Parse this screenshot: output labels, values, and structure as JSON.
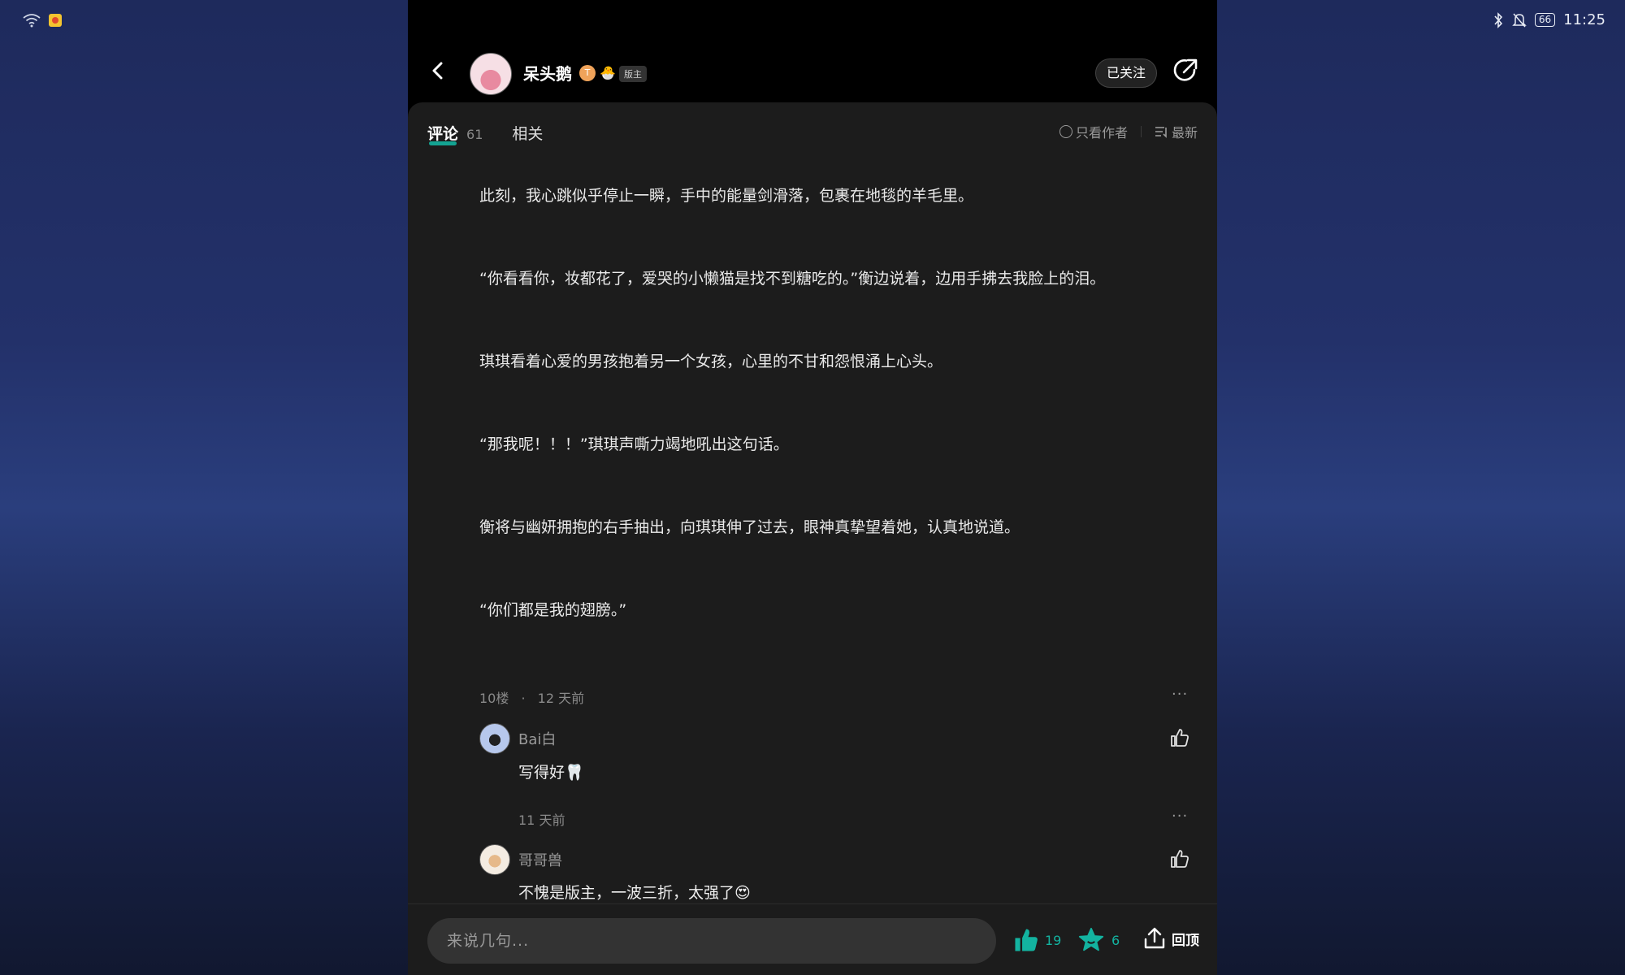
{
  "status_bar": {
    "time": "11:25",
    "battery": "66",
    "icons": [
      "wifi-icon",
      "app-notification-icon",
      "bluetooth-icon",
      "mute-bell-icon",
      "battery-icon"
    ]
  },
  "header": {
    "author_name": "呆头鹅",
    "level_badge": "T",
    "emoji_badge": "🐣",
    "moderator_badge": "版主",
    "follow_label": "已关注"
  },
  "tabs": {
    "comments_label": "评论",
    "comments_count": "61",
    "related_label": "相关"
  },
  "filters": {
    "author_only": "只看作者",
    "sort": "最新"
  },
  "story": [
    "此刻，我心跳似乎停止一瞬，手中的能量剑滑落，包裹在地毯的羊毛里。",
    "“你看看你，妆都花了，爱哭的小懒猫是找不到糖吃的。”衡边说着，边用手拂去我脸上的泪。",
    "琪琪看着心爱的男孩抱着另一个女孩，心里的不甘和怨恨涌上心头。",
    "“那我呢！！！”琪琪声嘶力竭地吼出这句话。",
    "衡将与幽妍拥抱的右手抽出，向琪琪伸了过去，眼神真挚望着她，认真地说道。",
    "“你们都是我的翅膀。”"
  ],
  "post_meta": {
    "floor": "10楼",
    "dot": "·",
    "time": "12 天前",
    "more": "···"
  },
  "comments": [
    {
      "name": "Bai白",
      "text": "写得好",
      "emoji": "🦷",
      "time": "11 天前",
      "more": "···"
    },
    {
      "name": "哥哥兽",
      "text": "不愧是版主，一波三折，太强了",
      "emoji": "😍"
    }
  ],
  "bottom_bar": {
    "input_placeholder": "来说几句...",
    "likes": "19",
    "favorites": "6",
    "top_label": "回顶"
  },
  "colors": {
    "accent": "#13b3a0",
    "sheet_bg": "#1c1c1c",
    "header_bg": "#000000"
  }
}
